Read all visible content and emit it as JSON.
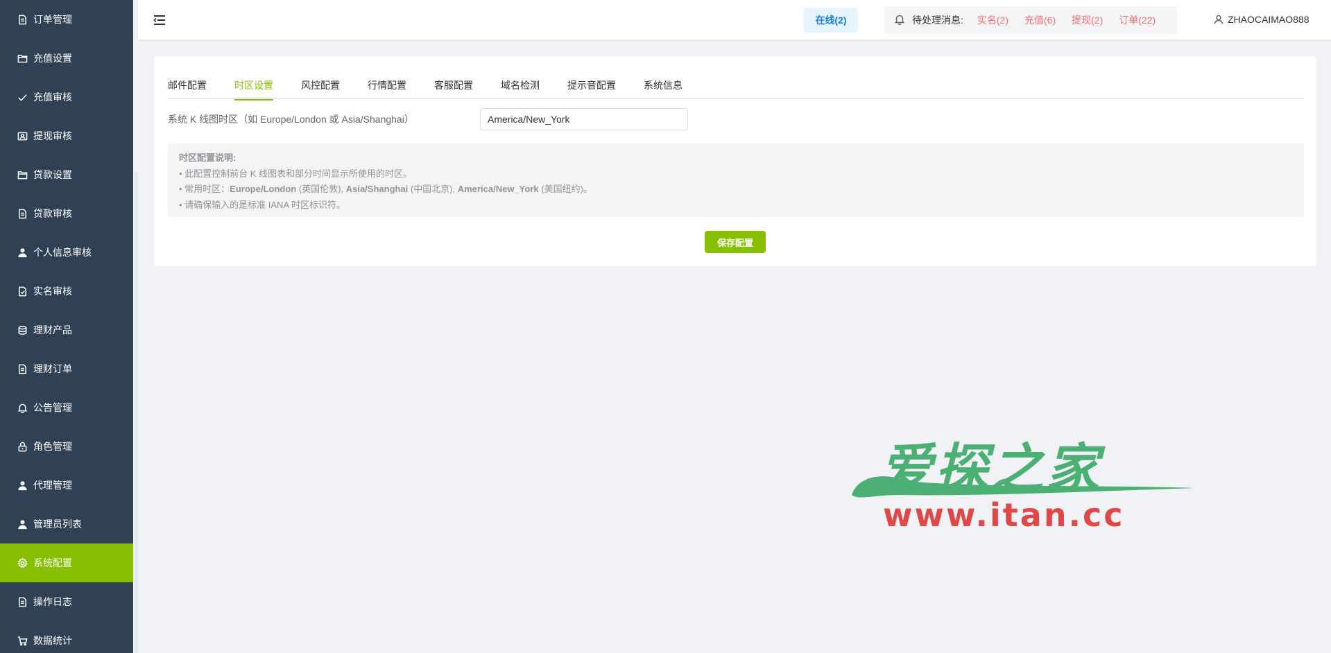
{
  "sidebar": {
    "items": [
      {
        "label": "订单管理",
        "icon": "document-icon",
        "active": false
      },
      {
        "label": "充值设置",
        "icon": "folder-icon",
        "active": false
      },
      {
        "label": "充值审核",
        "icon": "check-icon",
        "active": false
      },
      {
        "label": "提现审核",
        "icon": "id-card-icon",
        "active": false
      },
      {
        "label": "贷款设置",
        "icon": "folder-icon",
        "active": false
      },
      {
        "label": "贷款审核",
        "icon": "document-icon",
        "active": false
      },
      {
        "label": "个人信息审核",
        "icon": "user-icon",
        "active": false
      },
      {
        "label": "实名审核",
        "icon": "document-check-icon",
        "active": false
      },
      {
        "label": "理财产品",
        "icon": "coins-icon",
        "active": false
      },
      {
        "label": "理财订单",
        "icon": "document-icon",
        "active": false
      },
      {
        "label": "公告管理",
        "icon": "bell-icon",
        "active": false
      },
      {
        "label": "角色管理",
        "icon": "lock-icon",
        "active": false
      },
      {
        "label": "代理管理",
        "icon": "user-icon",
        "active": false
      },
      {
        "label": "管理员列表",
        "icon": "user-icon",
        "active": false
      },
      {
        "label": "系统配置",
        "icon": "gear-icon",
        "active": true
      },
      {
        "label": "操作日志",
        "icon": "document-icon",
        "active": false
      },
      {
        "label": "数据统计",
        "icon": "cart-icon",
        "active": false
      }
    ]
  },
  "header": {
    "online": "在线(2)",
    "pending_label": "待处理消息:",
    "pending": [
      {
        "label": "实名(2)"
      },
      {
        "label": "充值(6)"
      },
      {
        "label": "提现(2)"
      },
      {
        "label": "订单(22)"
      }
    ],
    "username": "ZHAOCAIMAO888"
  },
  "tabs": [
    {
      "label": "邮件配置",
      "active": false
    },
    {
      "label": "时区设置",
      "active": true
    },
    {
      "label": "风控配置",
      "active": false
    },
    {
      "label": "行情配置",
      "active": false
    },
    {
      "label": "客服配置",
      "active": false
    },
    {
      "label": "域名检测",
      "active": false
    },
    {
      "label": "提示音配置",
      "active": false
    },
    {
      "label": "系统信息",
      "active": false
    }
  ],
  "form": {
    "timezone_label": "系统 K 线图时区（如 Europe/London 或 Asia/Shanghai）",
    "timezone_value": "America/New_York"
  },
  "notice": {
    "title": "时区配置说明:",
    "line1": "• 此配置控制前台 K 线图表和部分时间显示所使用的时区。",
    "line2_prefix": "• 常用时区：",
    "tz1": "Europe/London",
    "tz1_note": " (英国伦敦), ",
    "tz2": "Asia/Shanghai",
    "tz2_note": " (中国北京), ",
    "tz3": "America/New_York",
    "tz3_note": " (美国纽约)。",
    "line3": "• 请确保输入的是标准 IANA 时区标识符。"
  },
  "save_label": "保存配置",
  "watermark": {
    "top": "爱探之家",
    "url": "www.itan.cc"
  },
  "colors": {
    "sidebar_bg": "#304156",
    "accent": "#87c000",
    "alert": "#f56c6c",
    "online": "#1a7fd6"
  }
}
